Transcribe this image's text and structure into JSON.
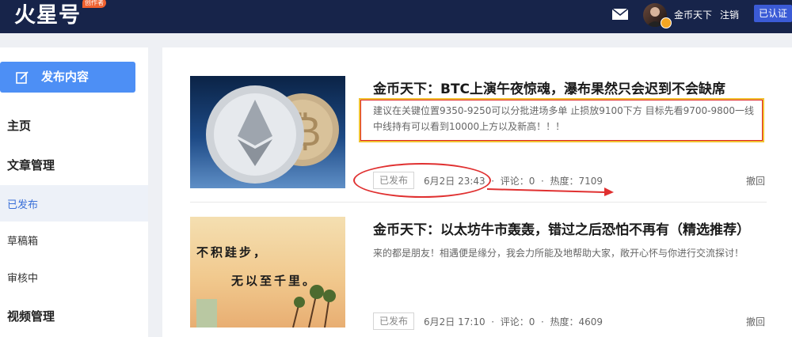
{
  "header": {
    "logo_text": "火星号",
    "logo_badge": "创作者",
    "user_name": "金币天下",
    "logout_label": "注销",
    "verified_label": "已认证",
    "mail_icon": "mail-icon",
    "colors": {
      "bar": "#17244a",
      "accent": "#3b5bd6"
    }
  },
  "sidebar": {
    "publish_label": "发布内容",
    "publish_icon": "edit-icon",
    "items": [
      {
        "label": "主页"
      },
      {
        "label": "文章管理"
      },
      {
        "label": "已发布"
      },
      {
        "label": "草稿箱"
      },
      {
        "label": "审核中"
      },
      {
        "label": "视频管理"
      }
    ],
    "colors": {
      "button": "#4d8ff5",
      "active": "#3a70d8"
    }
  },
  "articles": [
    {
      "title": "金币天下：BTC上演午夜惊魂，瀑布果然只会迟到不会缺席",
      "summary": "建议在关键位置9350-9250可以分批进场多单 止损放9100下方 目标先看9700-9800一线 中线持有可以看到10000上方以及新高！！！",
      "status": "已发布",
      "date": "6月2日 23:43",
      "comments": "评论：0",
      "heat": "热度：7109",
      "withdraw": "撤回"
    },
    {
      "title": "金币天下：以太坊牛市轰轰，错过之后恐怕不再有（精选推荐）",
      "summary": "来的都是朋友！相遇便是缘分，我会力所能及地帮助大家，敞开心怀与你进行交流探讨！",
      "thumb_text_1": "不积跬步，",
      "thumb_text_2": "无以至千里。",
      "status": "已发布",
      "date": "6月2日 17:10",
      "comments": "评论：0",
      "heat": "热度：4609",
      "withdraw": "撤回"
    }
  ]
}
